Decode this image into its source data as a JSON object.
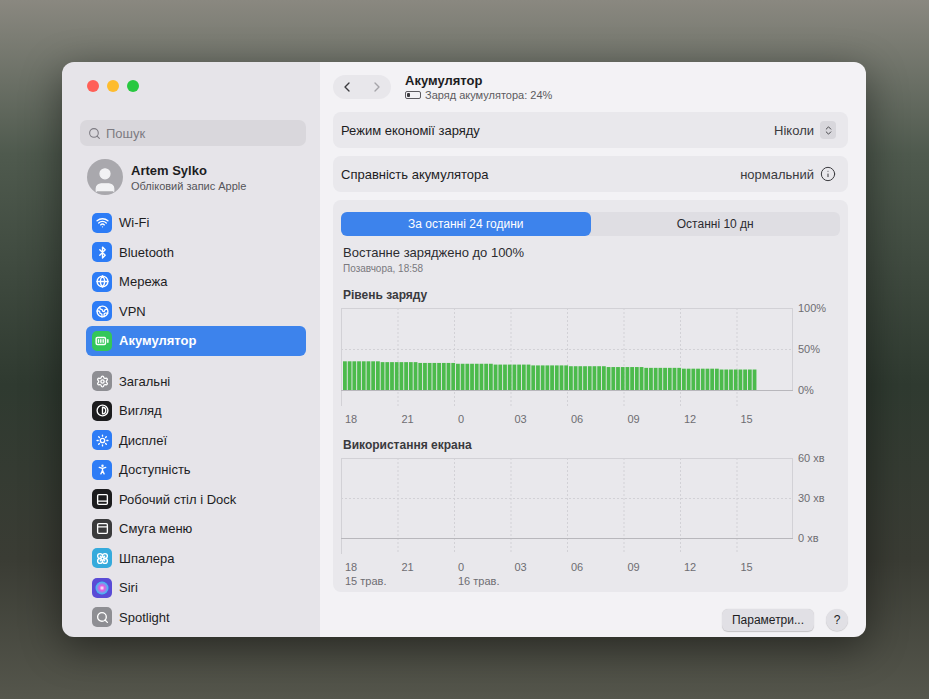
{
  "window": {
    "title": "Акумулятор",
    "subtitle": "Заряд акумулятора: 24%",
    "battery_level": 0.24
  },
  "search": {
    "placeholder": "Пошук"
  },
  "account": {
    "name": "Artem Sylko",
    "subtitle": "Обліковий запис Apple"
  },
  "sidebar": {
    "groups": [
      {
        "items": [
          {
            "label": "Wi-Fi",
            "selected": false,
            "color": "#2d7cf6"
          },
          {
            "label": "Bluetooth",
            "selected": false,
            "color": "#2d7cf6"
          },
          {
            "label": "Мережа",
            "selected": false,
            "color": "#2d7cf6"
          },
          {
            "label": "VPN",
            "selected": false,
            "color": "#2d7cf6"
          },
          {
            "label": "Акумулятор",
            "selected": true,
            "color": "#34c759"
          }
        ]
      },
      {
        "items": [
          {
            "label": "Загальні",
            "selected": false,
            "color": "#8e8e93"
          },
          {
            "label": "Вигляд",
            "selected": false,
            "color": "#1c1c1e"
          },
          {
            "label": "Дисплеї",
            "selected": false,
            "color": "#2d7cf6"
          },
          {
            "label": "Доступність",
            "selected": false,
            "color": "#2d7cf6"
          },
          {
            "label": "Робочий стіл і Dock",
            "selected": false,
            "color": "#1c1c1e"
          },
          {
            "label": "Смуга меню",
            "selected": false,
            "color": "#3a3a3c"
          },
          {
            "label": "Шпалера",
            "selected": false,
            "color": "#35aadc"
          },
          {
            "label": "Siri",
            "selected": false,
            "color": "#5a4bd6"
          },
          {
            "label": "Spotlight",
            "selected": false,
            "color": "#8e8e93"
          }
        ]
      }
    ]
  },
  "settings": [
    {
      "label": "Режим економії заряду",
      "value": "Ніколи",
      "kind": "popup"
    },
    {
      "label": "Справність акумулятора",
      "value": "нормальний",
      "kind": "info"
    }
  ],
  "range_tabs": [
    {
      "label": "За останні 24 години",
      "selected": true
    },
    {
      "label": "Останні 10 дн",
      "selected": false
    }
  ],
  "last_charged": {
    "title": "Востанне заряджено до 100%",
    "time": "Позавчора, 18:58"
  },
  "charts": [
    {
      "title": "Рівень заряду",
      "y_ticks": [
        "100%",
        "50%",
        "0%"
      ],
      "y_max": 100,
      "color": "#4cbb4c",
      "x_ticks": [
        {
          "label": "18"
        },
        {
          "label": "21"
        },
        {
          "label": "0"
        },
        {
          "label": "03"
        },
        {
          "label": "06"
        },
        {
          "label": "09"
        },
        {
          "label": "12"
        },
        {
          "label": "15"
        }
      ],
      "values": [
        35,
        35,
        35,
        35,
        35,
        35,
        35,
        35,
        34,
        34,
        34,
        34,
        34,
        34,
        34,
        34,
        33,
        33,
        33,
        33,
        33,
        33,
        33,
        33,
        32,
        32,
        32,
        32,
        32,
        32,
        32,
        32,
        31,
        31,
        31,
        31,
        31,
        31,
        31,
        31,
        30,
        30,
        30,
        30,
        30,
        30,
        30,
        30,
        29,
        29,
        29,
        29,
        29,
        29,
        29,
        29,
        28,
        28,
        28,
        28,
        28,
        28,
        28,
        28,
        27,
        27,
        27,
        27,
        27,
        27,
        27,
        27,
        26,
        26,
        26,
        26,
        26,
        26,
        26,
        26,
        25,
        25,
        25,
        25,
        25,
        25,
        25,
        25
      ]
    },
    {
      "title": "Використання екрана",
      "y_ticks": [
        "60 хв",
        "30 хв",
        "0 хв"
      ],
      "y_max": 60,
      "color": "#2d7cf6",
      "x_ticks": [
        {
          "label": "18",
          "date": "15 трав."
        },
        {
          "label": "21"
        },
        {
          "label": "0",
          "date": "16 трав."
        },
        {
          "label": "03"
        },
        {
          "label": "06"
        },
        {
          "label": "09"
        },
        {
          "label": "12"
        },
        {
          "label": "15"
        }
      ],
      "values": []
    }
  ],
  "buttons": {
    "options": "Параметри...",
    "help": "?"
  }
}
